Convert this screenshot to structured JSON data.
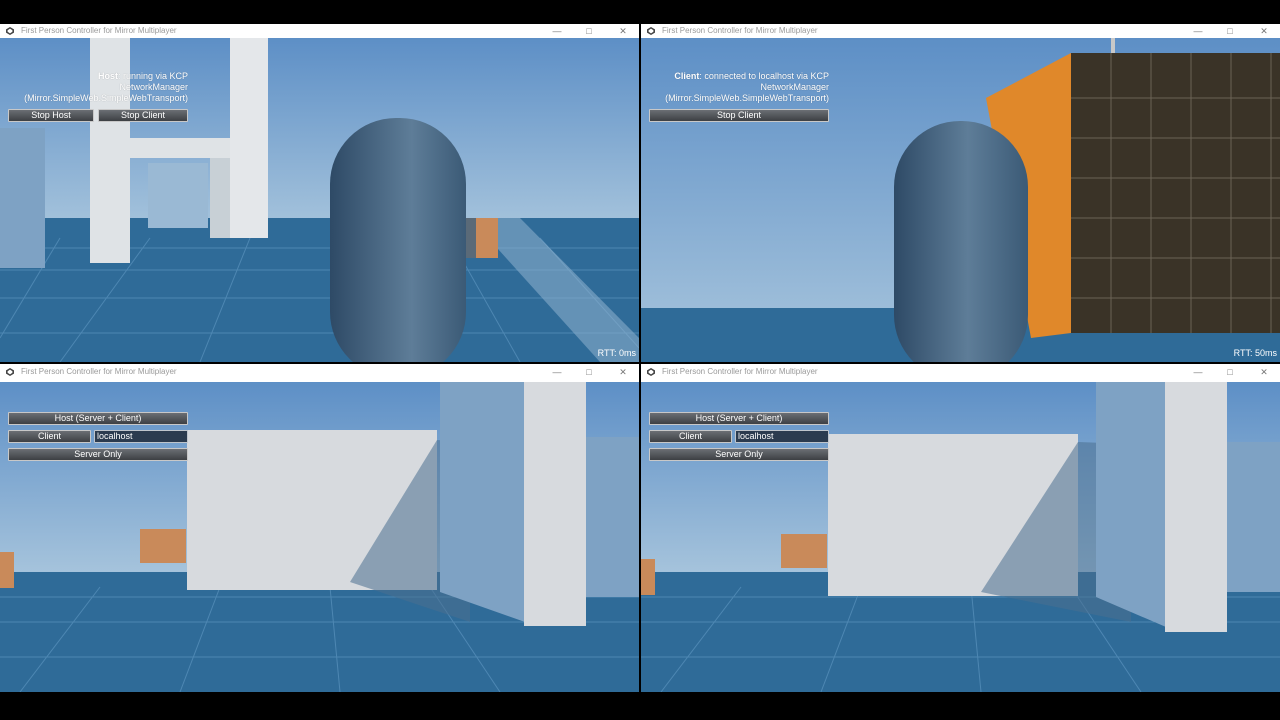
{
  "windows": [
    {
      "title": "First Person Controller for Mirror Multiplayer",
      "status_prefix": "Host",
      "status_rest": ": running via KCP",
      "status_line2": "NetworkManager",
      "status_line3": "(Mirror.SimpleWeb.SimpleWebTransport)",
      "buttons": [
        "Stop Host",
        "Stop Client"
      ],
      "rtt": "RTT: 0ms"
    },
    {
      "title": "First Person Controller for Mirror Multiplayer",
      "status_prefix": "Client",
      "status_rest": ": connected to localhost via KCP",
      "status_line2": "NetworkManager",
      "status_line3": "(Mirror.SimpleWeb.SimpleWebTransport)",
      "buttons": [
        "Stop Client"
      ],
      "rtt": "RTT: 50ms"
    },
    {
      "title": "First Person Controller for Mirror Multiplayer",
      "host_button": "Host (Server + Client)",
      "client_button": "Client",
      "address_value": "localhost",
      "server_button": "Server Only"
    },
    {
      "title": "First Person Controller for Mirror Multiplayer",
      "host_button": "Host (Server + Client)",
      "client_button": "Client",
      "address_value": "localhost",
      "server_button": "Server Only"
    }
  ],
  "window_controls": [
    "minimize",
    "maximize",
    "close"
  ],
  "icons": {
    "app": "unity-icon",
    "minimize": "minimize-icon",
    "maximize": "maximize-icon",
    "close": "close-icon"
  },
  "colors": {
    "sky": "#6f97c3",
    "ground": "#2f6b98",
    "capsule": "#3e5f7d",
    "orange": "#e0882a",
    "wall": "#d7dade"
  }
}
